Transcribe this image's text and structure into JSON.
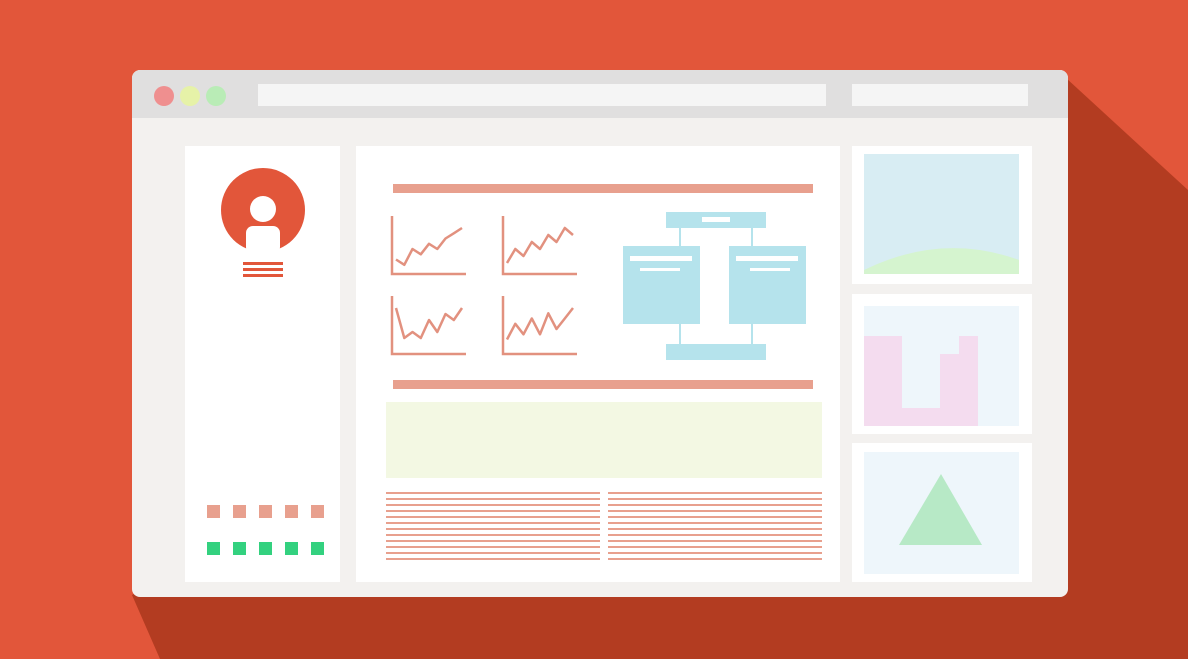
{
  "colors": {
    "background": "#e2563a",
    "shadow": "#b33c21",
    "window_frame": "#f3f1ef",
    "titlebar": "#e0dfdf",
    "panel": "#ffffff",
    "accent": "#e2563a",
    "salmon": "#e8a08e",
    "line_stroke": "#e2917f",
    "flow_blue": "#b5e3ec",
    "lime_box": "#f3f8e3",
    "sky_blue": "#d8edf3",
    "hill_green": "#d5f4cf",
    "pink_block": "#f4dcef",
    "tri_green": "#b7e9c6",
    "pale_blue": "#eef6fb",
    "dot_red": "#ef8f8f",
    "dot_yellow": "#e6f2a8",
    "dot_green": "#b9ecb6",
    "square_green": "#33d17f"
  },
  "window_controls": [
    "close-dot",
    "minimize-dot",
    "maximize-dot"
  ],
  "icons": {
    "avatar": "user-avatar-icon",
    "flowchart": "flowchart-icon",
    "landscape": "landscape-image-icon",
    "bar_chart": "bar-chart-icon",
    "triangle": "triangle-shape-icon"
  },
  "sidebar": {
    "salmon_squares": 5,
    "green_squares": 5
  },
  "chart_data": [
    {
      "type": "line",
      "series": [
        {
          "values": [
            2,
            1,
            4,
            3,
            5,
            4,
            6,
            7,
            8
          ]
        }
      ]
    },
    {
      "type": "line",
      "series": [
        {
          "values": [
            1,
            3,
            2,
            4,
            3,
            5,
            4,
            6,
            5
          ]
        }
      ]
    },
    {
      "type": "line",
      "series": [
        {
          "values": [
            7,
            2,
            3,
            2,
            5,
            3,
            6,
            5,
            7
          ]
        }
      ]
    },
    {
      "type": "line",
      "series": [
        {
          "values": [
            2,
            5,
            3,
            6,
            3,
            7,
            4,
            6,
            8
          ]
        }
      ]
    },
    {
      "type": "bar",
      "series": [
        {
          "values": [
            5,
            5,
            1,
            1,
            4,
            5
          ]
        }
      ]
    }
  ]
}
